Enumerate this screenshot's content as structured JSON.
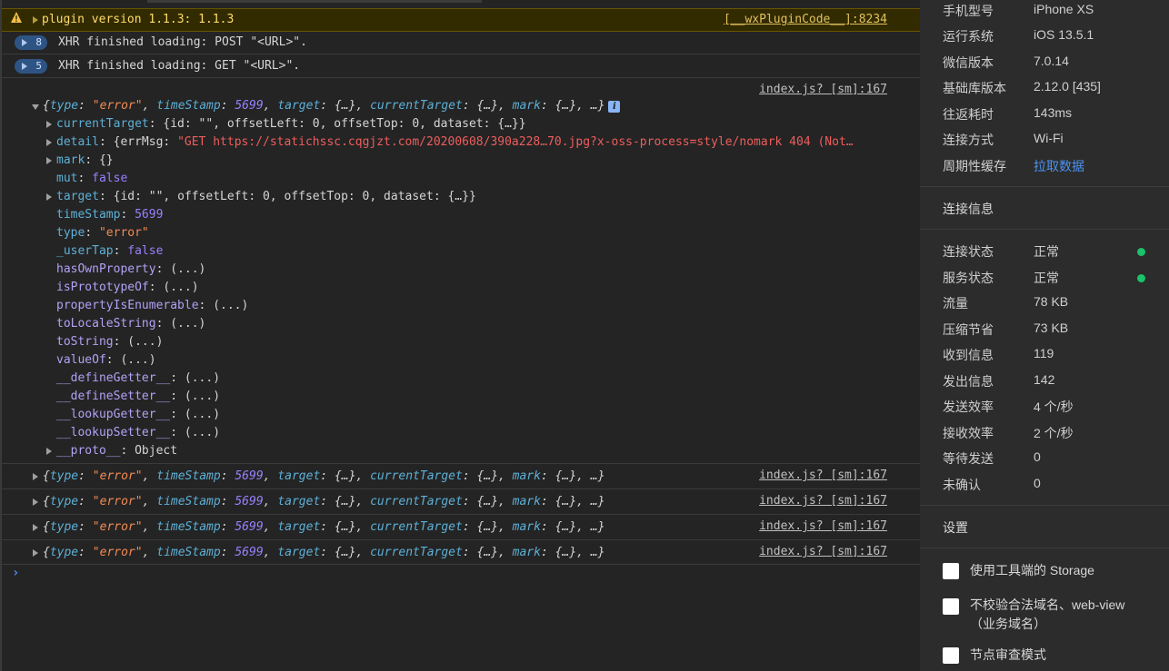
{
  "console": {
    "warning": {
      "text": "plugin version 1.1.3: 1.1.3",
      "source": "[__wxPluginCode__]:8234"
    },
    "xhr_messages": [
      {
        "count": "8",
        "text": "XHR finished loading: POST \"<URL>\"."
      },
      {
        "count": "5",
        "text": "XHR finished loading: GET \"<URL>\"."
      }
    ],
    "expanded_source": "index.js? [sm]:167",
    "expanded_summary": {
      "open": "{",
      "type_key": "type",
      "type_val": "\"error\"",
      "ts_key": "timeStamp",
      "ts_val": "5699",
      "target_key": "target",
      "ct_key": "currentTarget",
      "mark_key": "mark",
      "obj": "{…}",
      "ellipsis": "…}"
    },
    "props": {
      "currentTarget": {
        "key": "currentTarget",
        "value": "{id: \"\", offsetLeft: 0, offsetTop: 0, dataset: {…}}"
      },
      "detail_key": "detail",
      "detail_prefix": "{errMsg: ",
      "detail_value": "\"GET https://statichssc.cqgjzt.com/20200608/390a228…70.jpg?x-oss-process=style/nomark 404 (Not…",
      "mark": {
        "key": "mark",
        "value": "{}"
      },
      "mut": {
        "key": "mut",
        "value": "false"
      },
      "target": {
        "key": "target",
        "value": "{id: \"\", offsetLeft: 0, offsetTop: 0, dataset: {…}}"
      },
      "timeStamp": {
        "key": "timeStamp",
        "value": "5699"
      },
      "type": {
        "key": "type",
        "value": "\"error\""
      },
      "userTap": {
        "key": "_userTap",
        "value": "false"
      },
      "methods": [
        "hasOwnProperty",
        "isPrototypeOf",
        "propertyIsEnumerable",
        "toLocaleString",
        "toString",
        "valueOf",
        "__defineGetter__",
        "__defineSetter__",
        "__lookupGetter__",
        "__lookupSetter__"
      ],
      "method_value": "(...)",
      "proto_key": "__proto__",
      "proto_value": "Object"
    },
    "collapsed_rows": [
      {
        "source": "index.js? [sm]:167"
      },
      {
        "source": "index.js? [sm]:167"
      },
      {
        "source": "index.js? [sm]:167"
      },
      {
        "source": "index.js? [sm]:167"
      }
    ],
    "prompt": "›"
  },
  "panel": {
    "device_info": [
      {
        "label": "手机型号",
        "value": "iPhone XS"
      },
      {
        "label": "运行系统",
        "value": "iOS 13.5.1"
      },
      {
        "label": "微信版本",
        "value": "7.0.14"
      },
      {
        "label": "基础库版本",
        "value": "2.12.0 [435]"
      },
      {
        "label": "往返耗时",
        "value": "143ms"
      },
      {
        "label": "连接方式",
        "value": "Wi-Fi"
      },
      {
        "label": "周期性缓存",
        "value": "拉取数据"
      }
    ],
    "connection_title": "连接信息",
    "connection_info": [
      {
        "label": "连接状态",
        "value": "正常",
        "status": "ok"
      },
      {
        "label": "服务状态",
        "value": "正常",
        "status": "ok"
      },
      {
        "label": "流量",
        "value": "78 KB"
      },
      {
        "label": "压缩节省",
        "value": "73 KB"
      },
      {
        "label": "收到信息",
        "value": "119"
      },
      {
        "label": "发出信息",
        "value": "142"
      },
      {
        "label": "发送效率",
        "value": "4 个/秒"
      },
      {
        "label": "接收效率",
        "value": "2 个/秒"
      },
      {
        "label": "等待发送",
        "value": "0"
      },
      {
        "label": "未确认",
        "value": "0"
      }
    ],
    "settings_title": "设置",
    "settings": [
      {
        "label": "使用工具端的 Storage",
        "checked": false
      },
      {
        "label": "不校验合法域名、web-view（业务域名）",
        "checked": false
      },
      {
        "label": "节点审查模式",
        "checked": false
      }
    ],
    "status_color": "#19c46a",
    "link_color": "#4c93f0"
  }
}
